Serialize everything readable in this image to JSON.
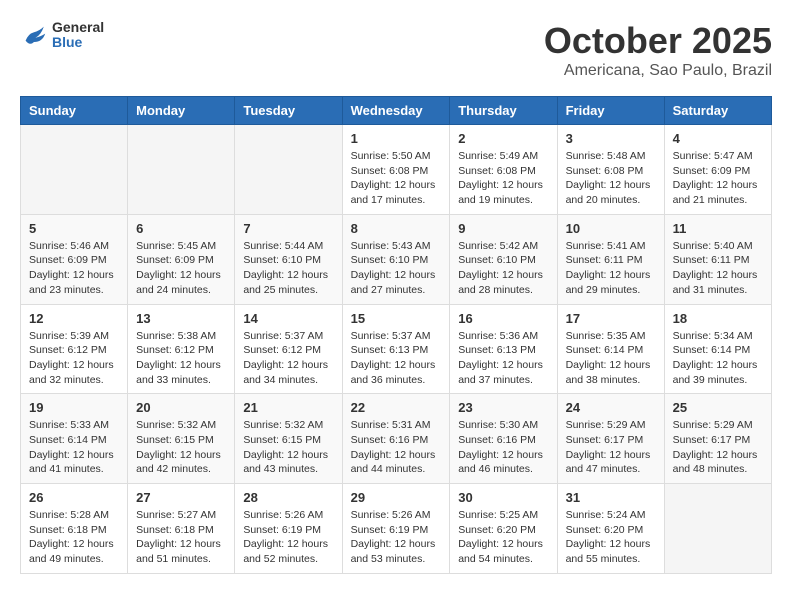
{
  "header": {
    "logo": {
      "general": "General",
      "blue": "Blue"
    },
    "title": "October 2025",
    "subtitle": "Americana, Sao Paulo, Brazil"
  },
  "calendar": {
    "headers": [
      "Sunday",
      "Monday",
      "Tuesday",
      "Wednesday",
      "Thursday",
      "Friday",
      "Saturday"
    ],
    "weeks": [
      [
        {
          "day": "",
          "info": ""
        },
        {
          "day": "",
          "info": ""
        },
        {
          "day": "",
          "info": ""
        },
        {
          "day": "1",
          "info": "Sunrise: 5:50 AM\nSunset: 6:08 PM\nDaylight: 12 hours\nand 17 minutes."
        },
        {
          "day": "2",
          "info": "Sunrise: 5:49 AM\nSunset: 6:08 PM\nDaylight: 12 hours\nand 19 minutes."
        },
        {
          "day": "3",
          "info": "Sunrise: 5:48 AM\nSunset: 6:08 PM\nDaylight: 12 hours\nand 20 minutes."
        },
        {
          "day": "4",
          "info": "Sunrise: 5:47 AM\nSunset: 6:09 PM\nDaylight: 12 hours\nand 21 minutes."
        }
      ],
      [
        {
          "day": "5",
          "info": "Sunrise: 5:46 AM\nSunset: 6:09 PM\nDaylight: 12 hours\nand 23 minutes."
        },
        {
          "day": "6",
          "info": "Sunrise: 5:45 AM\nSunset: 6:09 PM\nDaylight: 12 hours\nand 24 minutes."
        },
        {
          "day": "7",
          "info": "Sunrise: 5:44 AM\nSunset: 6:10 PM\nDaylight: 12 hours\nand 25 minutes."
        },
        {
          "day": "8",
          "info": "Sunrise: 5:43 AM\nSunset: 6:10 PM\nDaylight: 12 hours\nand 27 minutes."
        },
        {
          "day": "9",
          "info": "Sunrise: 5:42 AM\nSunset: 6:10 PM\nDaylight: 12 hours\nand 28 minutes."
        },
        {
          "day": "10",
          "info": "Sunrise: 5:41 AM\nSunset: 6:11 PM\nDaylight: 12 hours\nand 29 minutes."
        },
        {
          "day": "11",
          "info": "Sunrise: 5:40 AM\nSunset: 6:11 PM\nDaylight: 12 hours\nand 31 minutes."
        }
      ],
      [
        {
          "day": "12",
          "info": "Sunrise: 5:39 AM\nSunset: 6:12 PM\nDaylight: 12 hours\nand 32 minutes."
        },
        {
          "day": "13",
          "info": "Sunrise: 5:38 AM\nSunset: 6:12 PM\nDaylight: 12 hours\nand 33 minutes."
        },
        {
          "day": "14",
          "info": "Sunrise: 5:37 AM\nSunset: 6:12 PM\nDaylight: 12 hours\nand 34 minutes."
        },
        {
          "day": "15",
          "info": "Sunrise: 5:37 AM\nSunset: 6:13 PM\nDaylight: 12 hours\nand 36 minutes."
        },
        {
          "day": "16",
          "info": "Sunrise: 5:36 AM\nSunset: 6:13 PM\nDaylight: 12 hours\nand 37 minutes."
        },
        {
          "day": "17",
          "info": "Sunrise: 5:35 AM\nSunset: 6:14 PM\nDaylight: 12 hours\nand 38 minutes."
        },
        {
          "day": "18",
          "info": "Sunrise: 5:34 AM\nSunset: 6:14 PM\nDaylight: 12 hours\nand 39 minutes."
        }
      ],
      [
        {
          "day": "19",
          "info": "Sunrise: 5:33 AM\nSunset: 6:14 PM\nDaylight: 12 hours\nand 41 minutes."
        },
        {
          "day": "20",
          "info": "Sunrise: 5:32 AM\nSunset: 6:15 PM\nDaylight: 12 hours\nand 42 minutes."
        },
        {
          "day": "21",
          "info": "Sunrise: 5:32 AM\nSunset: 6:15 PM\nDaylight: 12 hours\nand 43 minutes."
        },
        {
          "day": "22",
          "info": "Sunrise: 5:31 AM\nSunset: 6:16 PM\nDaylight: 12 hours\nand 44 minutes."
        },
        {
          "day": "23",
          "info": "Sunrise: 5:30 AM\nSunset: 6:16 PM\nDaylight: 12 hours\nand 46 minutes."
        },
        {
          "day": "24",
          "info": "Sunrise: 5:29 AM\nSunset: 6:17 PM\nDaylight: 12 hours\nand 47 minutes."
        },
        {
          "day": "25",
          "info": "Sunrise: 5:29 AM\nSunset: 6:17 PM\nDaylight: 12 hours\nand 48 minutes."
        }
      ],
      [
        {
          "day": "26",
          "info": "Sunrise: 5:28 AM\nSunset: 6:18 PM\nDaylight: 12 hours\nand 49 minutes."
        },
        {
          "day": "27",
          "info": "Sunrise: 5:27 AM\nSunset: 6:18 PM\nDaylight: 12 hours\nand 51 minutes."
        },
        {
          "day": "28",
          "info": "Sunrise: 5:26 AM\nSunset: 6:19 PM\nDaylight: 12 hours\nand 52 minutes."
        },
        {
          "day": "29",
          "info": "Sunrise: 5:26 AM\nSunset: 6:19 PM\nDaylight: 12 hours\nand 53 minutes."
        },
        {
          "day": "30",
          "info": "Sunrise: 5:25 AM\nSunset: 6:20 PM\nDaylight: 12 hours\nand 54 minutes."
        },
        {
          "day": "31",
          "info": "Sunrise: 5:24 AM\nSunset: 6:20 PM\nDaylight: 12 hours\nand 55 minutes."
        },
        {
          "day": "",
          "info": ""
        }
      ]
    ]
  }
}
